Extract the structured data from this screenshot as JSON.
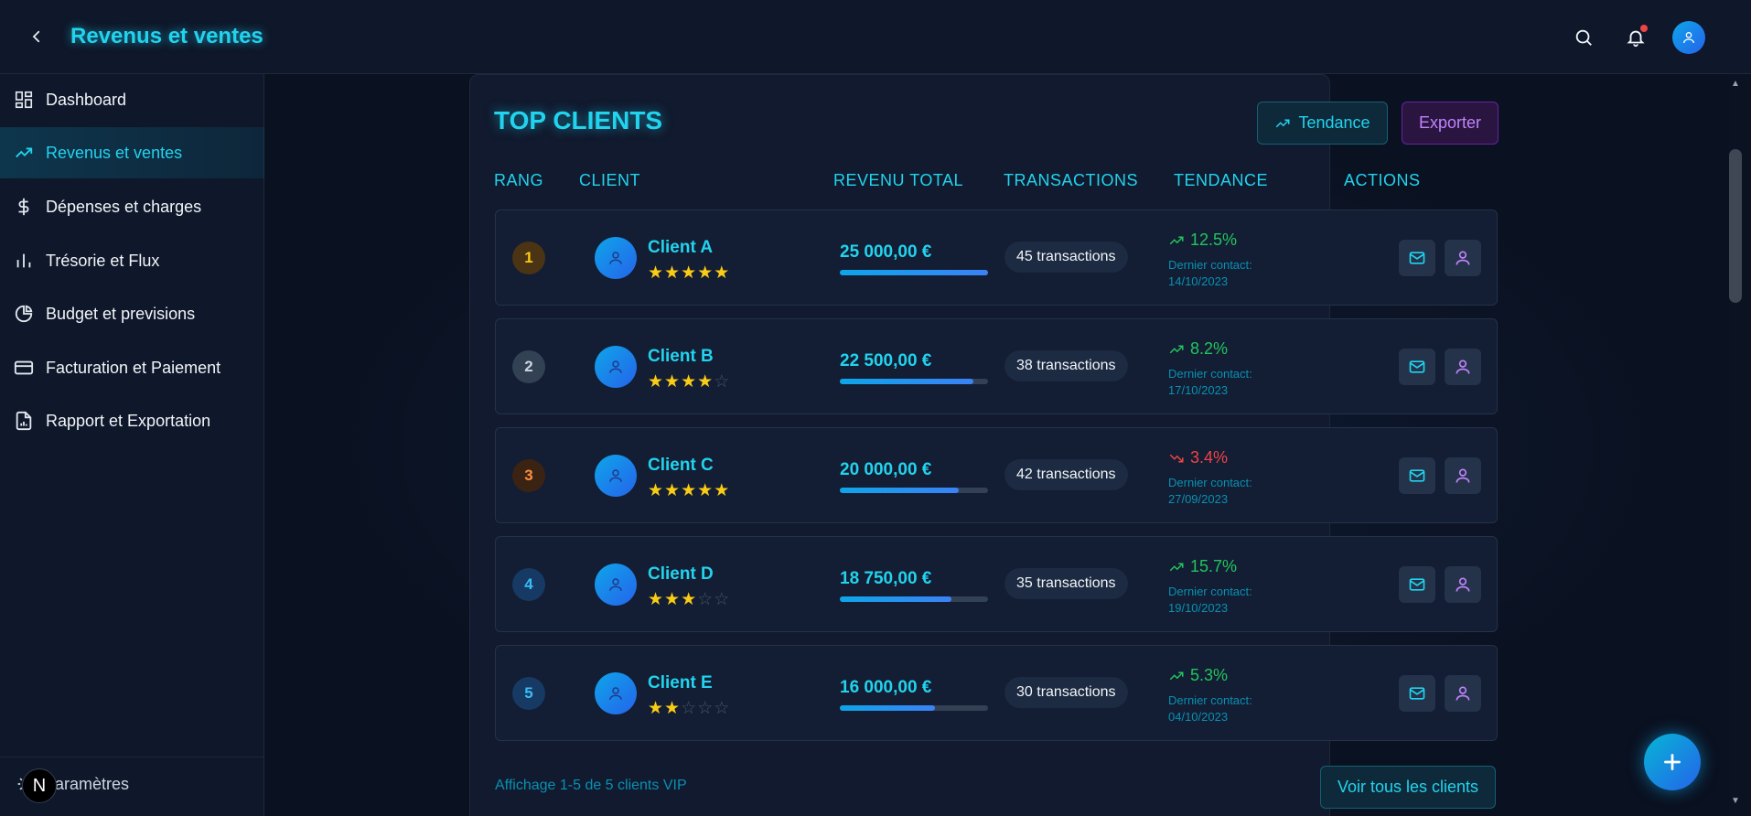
{
  "header": {
    "title": "Revenus et ventes",
    "back_icon": "chevron-left-icon",
    "search_icon": "search-icon",
    "notification_icon": "bell-icon",
    "avatar_icon": "user-icon"
  },
  "sidebar": {
    "items": [
      {
        "label": "Dashboard",
        "icon": "grid-icon",
        "active": false
      },
      {
        "label": "Revenus et ventes",
        "icon": "trending-up-icon",
        "active": true
      },
      {
        "label": "Dépenses et charges",
        "icon": "dollar-icon",
        "active": false
      },
      {
        "label": "Trésorie et Flux",
        "icon": "bar-chart-icon",
        "active": false
      },
      {
        "label": "Budget et previsions",
        "icon": "pie-chart-icon",
        "active": false
      },
      {
        "label": "Facturation et Paiement",
        "icon": "credit-card-icon",
        "active": false
      },
      {
        "label": "Rapport et Exportation",
        "icon": "file-chart-icon",
        "active": false
      }
    ],
    "settings_label": "Paramètres",
    "overlay_badge": "N"
  },
  "card": {
    "title": "TOP CLIENTS",
    "tendance_button": "Tendance",
    "export_button": "Exporter",
    "columns": [
      "RANG",
      "CLIENT",
      "REVENU TOTAL",
      "TRANSACTIONS",
      "TENDANCE",
      "ACTIONS"
    ],
    "rows": [
      {
        "rank": "1",
        "name": "Client A",
        "stars": 5,
        "revenue": "25 000,00 €",
        "revenue_fraction": 1.0,
        "transactions": "45 transactions",
        "trend": "12.5%",
        "trend_dir": "up",
        "contact_label": "Dernier contact:",
        "contact_date": "14/10/2023"
      },
      {
        "rank": "2",
        "name": "Client B",
        "stars": 4,
        "revenue": "22 500,00 €",
        "revenue_fraction": 0.9,
        "transactions": "38 transactions",
        "trend": "8.2%",
        "trend_dir": "up",
        "contact_label": "Dernier contact:",
        "contact_date": "17/10/2023"
      },
      {
        "rank": "3",
        "name": "Client C",
        "stars": 5,
        "revenue": "20 000,00 €",
        "revenue_fraction": 0.8,
        "transactions": "42 transactions",
        "trend": "3.4%",
        "trend_dir": "down",
        "contact_label": "Dernier contact:",
        "contact_date": "27/09/2023"
      },
      {
        "rank": "4",
        "name": "Client D",
        "stars": 3,
        "revenue": "18 750,00 €",
        "revenue_fraction": 0.75,
        "transactions": "35 transactions",
        "trend": "15.7%",
        "trend_dir": "up",
        "contact_label": "Dernier contact:",
        "contact_date": "19/10/2023"
      },
      {
        "rank": "5",
        "name": "Client E",
        "stars": 2,
        "revenue": "16 000,00 €",
        "revenue_fraction": 0.64,
        "transactions": "30 transactions",
        "trend": "5.3%",
        "trend_dir": "up",
        "contact_label": "Dernier contact:",
        "contact_date": "04/10/2023"
      }
    ],
    "footer_text": "Affichage 1-5 de 5 clients VIP",
    "view_all_button": "Voir tous les clients"
  },
  "colors": {
    "accent": "#22d3ee",
    "purple": "#c084fc",
    "up": "#22c55e",
    "down": "#ef4444",
    "star": "#facc15"
  }
}
